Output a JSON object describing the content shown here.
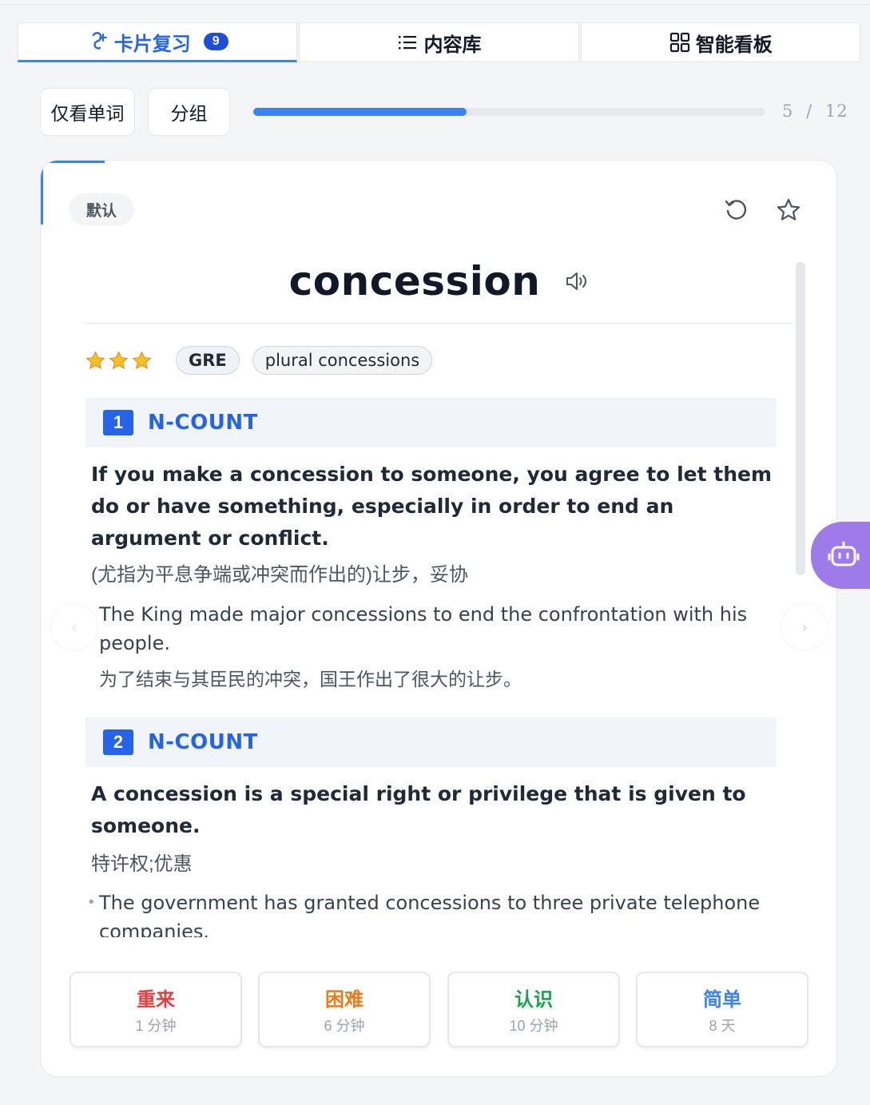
{
  "tabs": [
    {
      "label": "卡片复习",
      "badge": "9",
      "icon": "flashcard-icon",
      "active": true
    },
    {
      "label": "内容库",
      "icon": "list-icon",
      "active": false
    },
    {
      "label": "智能看板",
      "icon": "dashboard-icon",
      "active": false
    }
  ],
  "controls": {
    "words_only_label": "仅看单词",
    "group_label": "分组",
    "progress": {
      "current": "5",
      "separator": "/",
      "total": "12",
      "fraction": 0.4167
    }
  },
  "card": {
    "group_tag": "默认",
    "undo_icon": "undo-icon",
    "favorite_icon": "star-outline-icon",
    "word": "concession",
    "speaker_icon": "speaker-icon",
    "stars": 3,
    "tags": [
      "GRE",
      "plural concessions"
    ],
    "senses": [
      {
        "number": "1",
        "pos": "N-COUNT",
        "definition_en": "If you make a concession to someone, you agree to let them do or have something, especially in order to end an argument or conflict.",
        "definition_zh": "(尤指为平息争端或冲突而作出的)让步，妥协",
        "example_en": "The King made major concessions to end the confrontation with his people.",
        "example_zh": "为了结束与其臣民的冲突，国王作出了很大的让步。"
      },
      {
        "number": "2",
        "pos": "N-COUNT",
        "definition_en": "A concession is a special right or privilege that is given to someone.",
        "definition_zh": "特许权;优惠",
        "example_en": "The government has granted concessions to three private telephone companies."
      }
    ],
    "prev_label": "‹",
    "next_label": "›"
  },
  "rating_buttons": [
    {
      "title": "重来",
      "interval": "1 分钟",
      "color": "#e53e3e"
    },
    {
      "title": "困难",
      "interval": "6 分钟",
      "color": "#ea7a1a"
    },
    {
      "title": "认识",
      "interval": "10 分钟",
      "color": "#16a34a"
    },
    {
      "title": "简单",
      "interval": "8 天",
      "color": "#3b82f6"
    }
  ],
  "assistant_icon": "robot-icon"
}
